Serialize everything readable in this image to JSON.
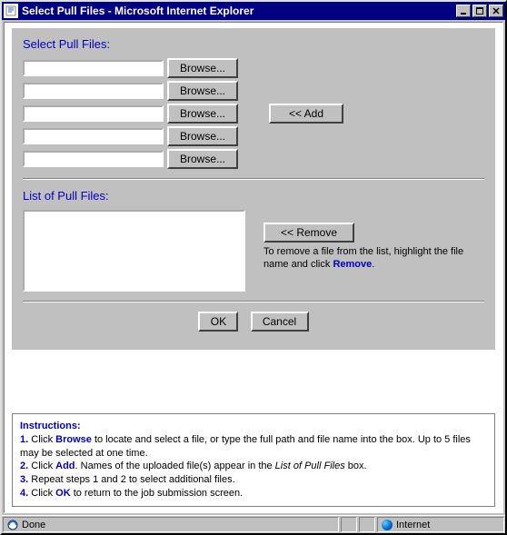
{
  "window": {
    "title": "Select Pull Files - Microsoft Internet Explorer"
  },
  "select": {
    "heading": "Select Pull Files:",
    "rows": [
      {
        "value": "",
        "browse": "Browse..."
      },
      {
        "value": "",
        "browse": "Browse..."
      },
      {
        "value": "",
        "browse": "Browse..."
      },
      {
        "value": "",
        "browse": "Browse..."
      },
      {
        "value": "",
        "browse": "Browse..."
      }
    ],
    "add_label": "<< Add"
  },
  "list": {
    "heading": "List of Pull Files:",
    "remove_label": "<< Remove",
    "remove_help_pre": "To remove a file from the list, highlight the file name and click ",
    "remove_help_kw": "Remove",
    "remove_help_post": "."
  },
  "actions": {
    "ok": "OK",
    "cancel": "Cancel"
  },
  "instructions": {
    "heading": "Instructions:",
    "l1n": "1.",
    "l1a": " Click ",
    "l1k": "Browse",
    "l1b": " to locate and select a file, or type the full path and file name into the box. Up to 5 files may be selected at one time.",
    "l2n": "2.",
    "l2a": " Click ",
    "l2k": "Add",
    "l2b": ". Names of the uploaded file(s) appear in the ",
    "l2i": "List of Pull Files",
    "l2c": " box.",
    "l3n": "3.",
    "l3a": " Repeat steps 1 and 2 to select additional files.",
    "l4n": "4.",
    "l4a": " Click ",
    "l4k": "OK",
    "l4b": " to return to the job submission screen."
  },
  "status": {
    "text": "Done",
    "zone": "Internet"
  }
}
